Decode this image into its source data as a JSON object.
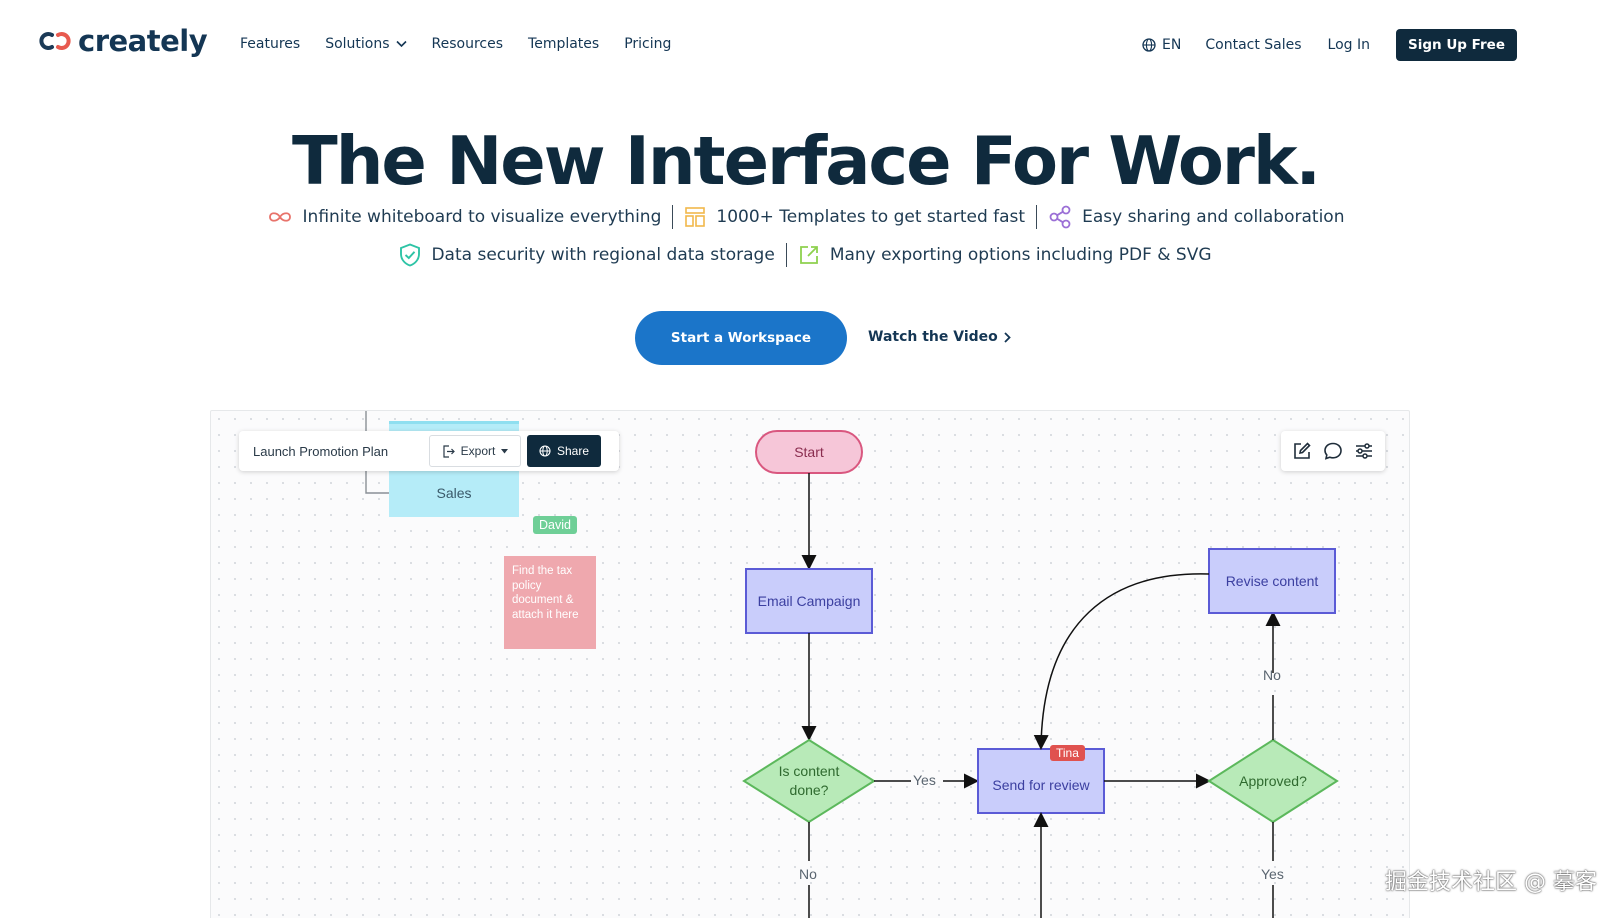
{
  "brand": {
    "name": "creately"
  },
  "nav": {
    "links": [
      {
        "label": "Features"
      },
      {
        "label": "Solutions"
      },
      {
        "label": "Resources"
      },
      {
        "label": "Templates"
      },
      {
        "label": "Pricing"
      }
    ],
    "language": "EN",
    "contact_sales": "Contact Sales",
    "log_in": "Log In",
    "sign_up": "Sign Up Free"
  },
  "hero": {
    "title": "The New Interface For Work.",
    "features_row1": [
      {
        "icon": "infinity-icon",
        "text": "Infinite whiteboard to visualize everything"
      },
      {
        "icon": "templates-icon",
        "text": "1000+ Templates to get started fast"
      },
      {
        "icon": "share-nodes-icon",
        "text": "Easy sharing and collaboration"
      }
    ],
    "features_row2": [
      {
        "icon": "shield-check-icon",
        "text": "Data security with regional data storage"
      },
      {
        "icon": "export-icon",
        "text": "Many exporting options including PDF & SVG"
      }
    ],
    "cta_primary": "Start a Workspace",
    "cta_secondary": "Watch the Video"
  },
  "canvas": {
    "document_title": "Launch Promotion Plan",
    "export_label": "Export",
    "share_label": "Share",
    "right_tools": [
      "edit-icon",
      "comment-icon",
      "settings-sliders-icon"
    ],
    "sales_label": "Sales",
    "sticky_note": "Find the tax policy document & attach it here",
    "collaborators": [
      {
        "name": "David",
        "color": "#6fcf97"
      },
      {
        "name": "Tina",
        "color": "#e0524f"
      }
    ],
    "flow": {
      "start": "Start",
      "email": "Email Campaign",
      "content_done": "Is content done?",
      "send_review": "Send for review",
      "approved": "Approved?",
      "revise": "Revise content",
      "edge_yes_1": "Yes",
      "edge_no_1": "No",
      "edge_no_2": "No",
      "edge_yes_2": "Yes"
    }
  },
  "watermark": "掘金技术社区 @ 摹客",
  "colors": {
    "primary_dark": "#0f2a3d",
    "cta_blue": "#1b75c9",
    "node_purple_fill": "#c9cdfb",
    "node_purple_stroke": "#5b5bd6",
    "node_green_fill": "#b8eab8",
    "node_green_stroke": "#5cb85c",
    "start_pink_fill": "#f6c6d8",
    "start_pink_stroke": "#d9577f"
  }
}
